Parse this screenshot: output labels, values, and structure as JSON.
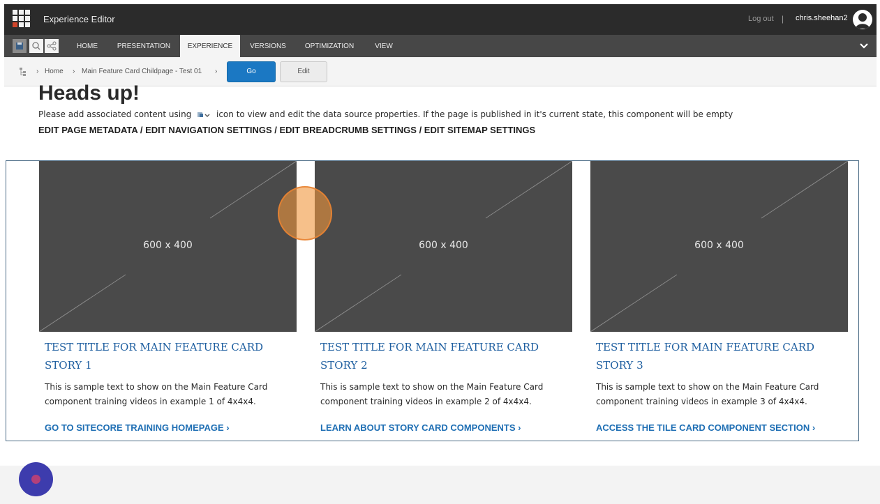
{
  "app": {
    "title": "Experience Editor",
    "logout_label": "Log out",
    "separator": "|",
    "username": "chris.sheehan2"
  },
  "ribbon": {
    "tabs": [
      "HOME",
      "PRESENTATION",
      "EXPERIENCE",
      "VERSIONS",
      "OPTIMIZATION",
      "VIEW"
    ],
    "active_tab": "EXPERIENCE"
  },
  "breadcrumb": {
    "items": [
      "Home",
      "Main Feature Card Childpage - Test 01"
    ],
    "go_label": "Go",
    "edit_label": "Edit"
  },
  "notice": {
    "heading": "Heads up!",
    "text_before_icon": "Please add associated content using",
    "text_after_icon": "icon to view and edit the data source properties. If the page is published in it's current state, this component will be empty",
    "edit_links": [
      "EDIT PAGE METADATA",
      "EDIT NAVIGATION SETTINGS",
      "EDIT BREADCRUMB SETTINGS",
      "EDIT SITEMAP SETTINGS"
    ],
    "link_separator": " / "
  },
  "cards": [
    {
      "placeholder": "600 x 400",
      "title_line1": "TEST TITLE FOR MAIN FEATURE CARD",
      "title_line2": "STORY 1",
      "text": "This is sample text to show on the Main Feature Card component training videos in example 1 of 4x4x4.",
      "link": "GO TO SITECORE TRAINING HOMEPAGE"
    },
    {
      "placeholder": "600 x 400",
      "title_line1": "TEST TITLE FOR MAIN FEATURE CARD",
      "title_line2": "STORY 2",
      "text": "This is sample text to show on the Main Feature Card component training videos in example 2 of 4x4x4.",
      "link": "LEARN ABOUT STORY CARD COMPONENTS"
    },
    {
      "placeholder": "600 x 400",
      "title_line1": "TEST TITLE FOR MAIN FEATURE CARD",
      "title_line2": "STORY 3",
      "text": "This is sample text to show on the Main Feature Card component training videos in example 3 of 4x4x4.",
      "link": "ACCESS THE TILE CARD COMPONENT SECTION"
    }
  ],
  "colors": {
    "topbar": "#2b2b2b",
    "ribbon": "#474747",
    "go_button": "#1b78c3",
    "card_title": "#1f5fa0",
    "card_link": "#1f6fb4",
    "placeholder": "#4a4a4a"
  },
  "icons": {
    "app": "app-grid-icon",
    "avatar": "user-avatar-icon",
    "save": "save-icon",
    "search": "search-icon",
    "share": "share-icon",
    "ribbon_toggle": "chevron-down-icon",
    "tree": "content-tree-icon",
    "datasource": "datasource-icon",
    "link_arrow": "chevron-right-icon"
  }
}
